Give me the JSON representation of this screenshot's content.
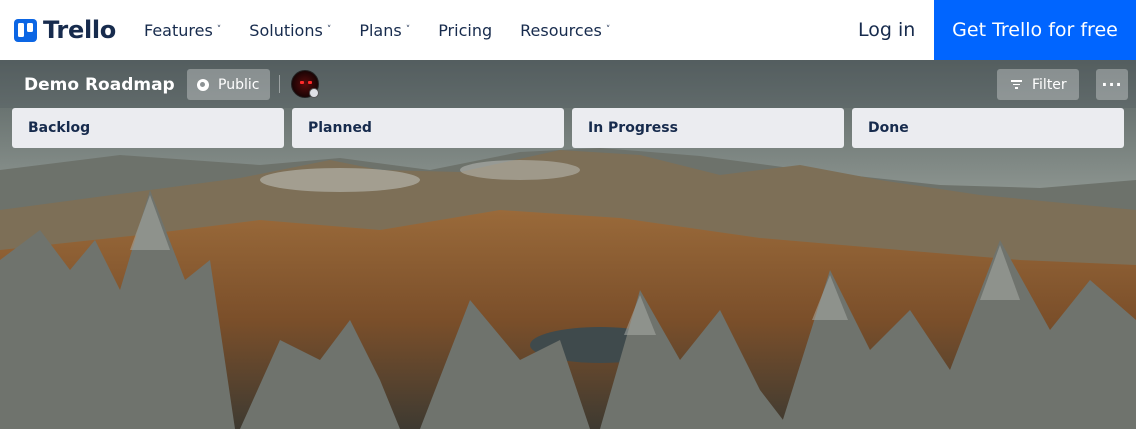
{
  "nav": {
    "brand": "Trello",
    "menu": [
      {
        "label": "Features",
        "has_dropdown": true
      },
      {
        "label": "Solutions",
        "has_dropdown": true
      },
      {
        "label": "Plans",
        "has_dropdown": true
      },
      {
        "label": "Pricing",
        "has_dropdown": false
      },
      {
        "label": "Resources",
        "has_dropdown": true
      }
    ],
    "chevron": "˅",
    "login": "Log in",
    "cta": "Get Trello for free"
  },
  "board": {
    "title": "Demo Roadmap",
    "visibility": "Public",
    "filter": "Filter",
    "more": "···"
  },
  "lists": [
    {
      "name": "Backlog"
    },
    {
      "name": "Planned"
    },
    {
      "name": "In Progress"
    },
    {
      "name": "Done"
    }
  ],
  "colors": {
    "brand_blue": "#0065ff",
    "text_dark": "#172b4d",
    "list_bg": "#ebecf0"
  }
}
